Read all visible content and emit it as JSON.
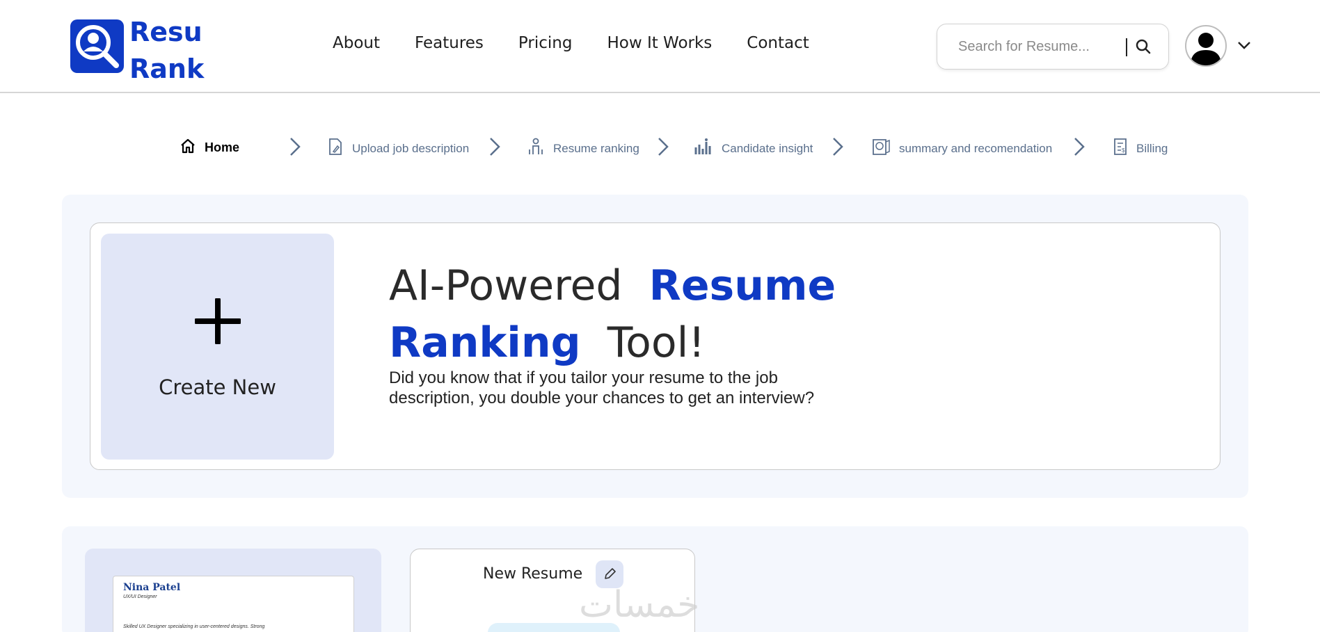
{
  "brand": {
    "line1": "Resu",
    "line2": "Rank",
    "color": "#0f3ac4"
  },
  "nav": [
    "About",
    "Features",
    "Pricing",
    "How It Works",
    "Contact"
  ],
  "search": {
    "placeholder": "Search for Resume..."
  },
  "steps": [
    {
      "label": "Home",
      "icon": "home-icon",
      "active": true
    },
    {
      "label": "Upload job description",
      "icon": "document-upload-icon"
    },
    {
      "label": "Resume ranking",
      "icon": "person-ranking-icon"
    },
    {
      "label": "Candidate insight",
      "icon": "bar-chart-icon"
    },
    {
      "label": "summary and recomendation",
      "icon": "globe-document-icon"
    },
    {
      "label": "Billing",
      "icon": "invoice-icon"
    }
  ],
  "hero": {
    "create_label": "Create New",
    "headline_part1": "AI-Powered",
    "headline_blue1": "Resume",
    "headline_blue2": "Ranking",
    "headline_part2": "Tool!",
    "subtext": "Did you know that if you tailor your resume to the job description, you double your chances to get an interview?"
  },
  "resumes": {
    "preview": {
      "name": "Nina Patel",
      "role": "UX/UI Designer",
      "summary": "Skilled UX Designer specializing in user-centered designs. Strong"
    },
    "new_card_title": "New Resume"
  },
  "watermark": "خمسات"
}
